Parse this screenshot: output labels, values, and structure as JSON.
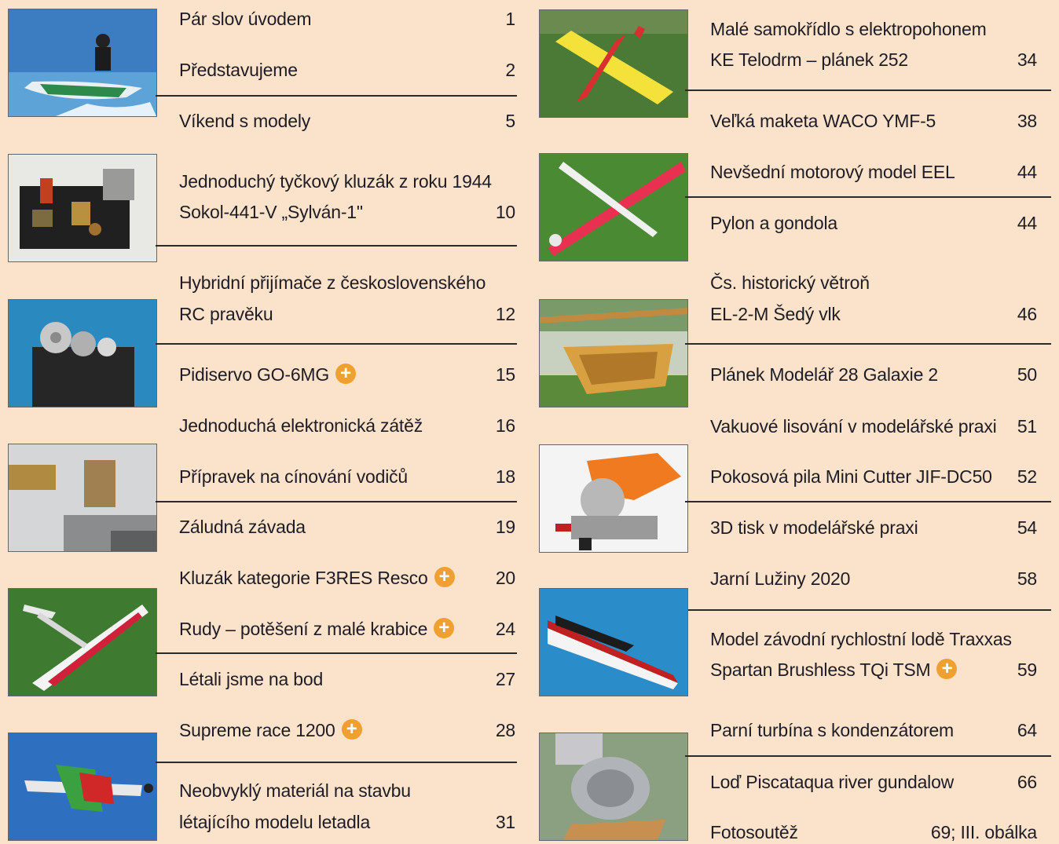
{
  "left": {
    "entries": [
      {
        "title": "Pár slov úvodem",
        "page": "1"
      },
      {
        "title": "Představujeme",
        "page": "2"
      },
      {
        "title": "Víkend s modely",
        "page": "5"
      },
      {
        "line1": "Jednoduchý tyčkový kluzák z roku 1944",
        "line2": "Sokol-441-V „Sylván-1\"",
        "page": "10"
      },
      {
        "line1": "Hybridní přijímače z československého",
        "line2": "RC pravěku",
        "page": "12"
      },
      {
        "title": "Pidiservo GO-6MG",
        "page": "15"
      },
      {
        "title": "Jednoduchá elektronická zátěž",
        "page": "16"
      },
      {
        "title": "Přípravek na cínování vodičů",
        "page": "18"
      },
      {
        "title": "Záludná závada",
        "page": "19"
      },
      {
        "title": "Kluzák kategorie F3RES Resco",
        "page": "20"
      },
      {
        "title": "Rudy – potěšení z malé krabice",
        "page": "24"
      },
      {
        "title": "Létali jsme na bod",
        "page": "27"
      },
      {
        "title": "Supreme race 1200",
        "page": "28"
      },
      {
        "line1": "Neobvyklý materiál na stavbu",
        "line2": "létajícího modelu letadla",
        "page": "31"
      }
    ]
  },
  "right": {
    "entries": [
      {
        "line1": "Malé samokřídlo s elektropohonem",
        "line2": "KE Telodrm – plánek 252",
        "page": "34"
      },
      {
        "title": "Veľká maketa WACO YMF-5",
        "page": "38"
      },
      {
        "title": "Nevšední motorový model EEL",
        "page": "44"
      },
      {
        "title": "Pylon a gondola",
        "page": "44"
      },
      {
        "line1": "Čs. historický větroň",
        "line2": "EL-2-M Šedý vlk",
        "page": "46"
      },
      {
        "title": "Plánek Modelář 28 Galaxie 2",
        "page": "50"
      },
      {
        "title": "Vakuové lisování v modelářské praxi",
        "page": "51"
      },
      {
        "title": "Pokosová pila Mini Cutter JIF-DC50",
        "page": "52"
      },
      {
        "title": "3D tisk v modelářské praxi",
        "page": "54"
      },
      {
        "title": "Jarní Lužiny 2020",
        "page": "58"
      },
      {
        "line1": "Model závodní rychlostní lodě Traxxas",
        "line2": "Spartan Brushless TQi TSM",
        "page": "59"
      },
      {
        "title": "Parní turbína s kondenzátorem",
        "page": "64"
      },
      {
        "title": "Loď Piscataqua river gundalow",
        "page": "66"
      },
      {
        "title": "Fotosoutěž",
        "page": "69; III. obálka"
      }
    ]
  },
  "plus_symbol": "+",
  "colors": {
    "background": "#fbe3cb",
    "accent": "#f0a030",
    "text": "#1e1c24"
  }
}
